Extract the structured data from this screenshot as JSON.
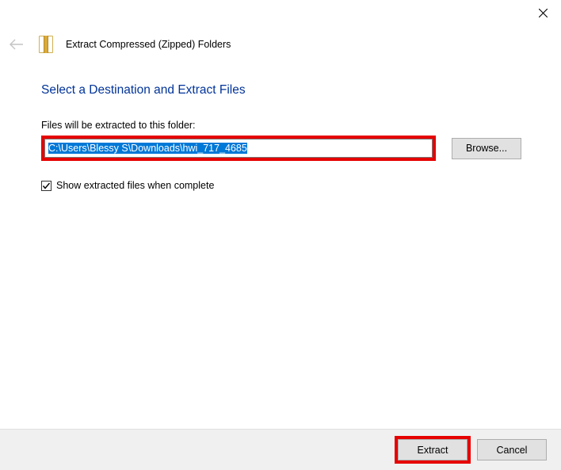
{
  "window": {
    "title": "Extract Compressed (Zipped) Folders"
  },
  "heading": "Select a Destination and Extract Files",
  "prompt": "Files will be extracted to this folder:",
  "path_value": "C:\\Users\\Blessy S\\Downloads\\hwi_717_4685",
  "browse_label": "Browse...",
  "checkbox": {
    "checked": true,
    "label": "Show extracted files when complete"
  },
  "footer": {
    "extract_label": "Extract",
    "cancel_label": "Cancel"
  }
}
